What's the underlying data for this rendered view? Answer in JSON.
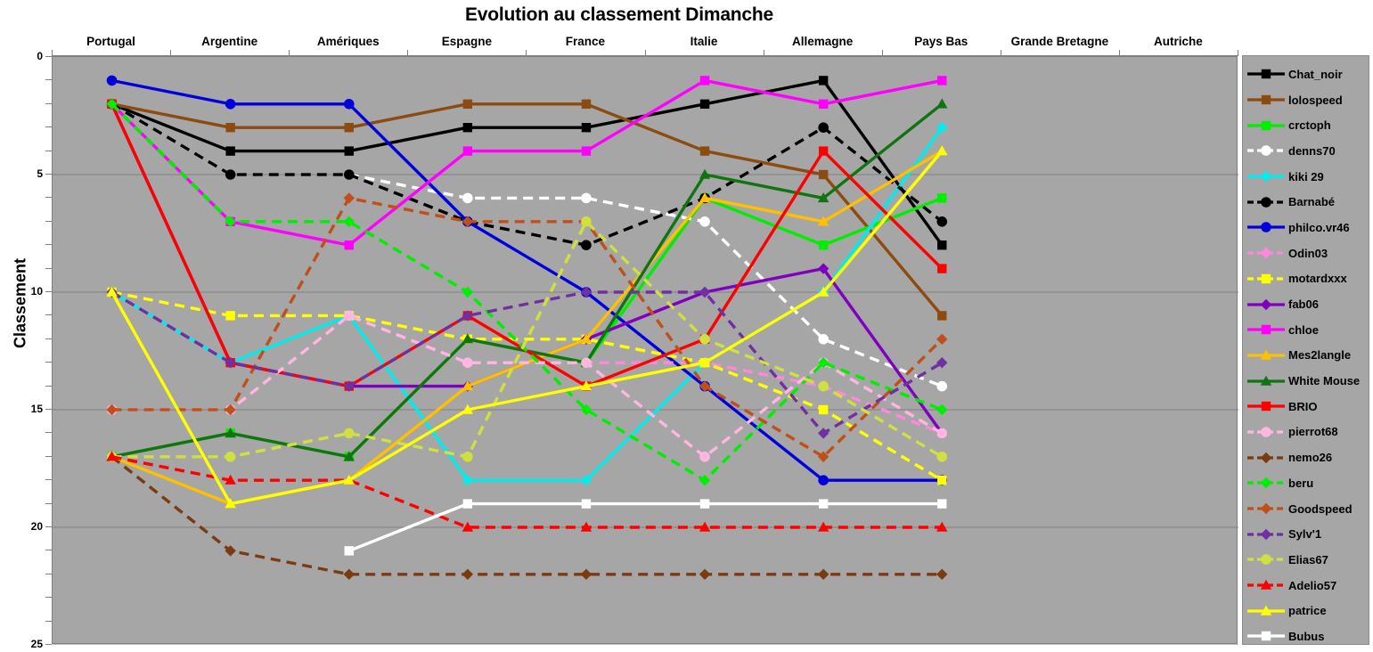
{
  "chart_data": {
    "type": "line",
    "title": "Evolution au classement Dimanche",
    "xlabel": "",
    "ylabel": "Classement",
    "categories": [
      "Portugal",
      "Argentine",
      "Amériques",
      "Espagne",
      "France",
      "Italie",
      "Allemagne",
      "Pays Bas",
      "Grande Bretagne",
      "Autriche"
    ],
    "x_tick_labels": [
      "Portugal",
      "Argentine",
      "Amériques",
      "Espagne",
      "France",
      "Italie",
      "Allemagne",
      "Pays Bas",
      "Grande Bretagne",
      "Autriche"
    ],
    "y_tick_labels": [
      "0",
      "5",
      "10",
      "15",
      "20",
      "25"
    ],
    "y_ticks": [
      0,
      5,
      10,
      15,
      20,
      25
    ],
    "ylim": [
      0,
      25
    ],
    "y_inverted": true,
    "grid": "horizontal",
    "legend_position": "right",
    "plot_background": "#a6a6a6",
    "series": [
      {
        "name": "Chat_noir",
        "color": "#000000",
        "marker": "square",
        "dash": "solid",
        "values": [
          2,
          4,
          4,
          3,
          3,
          2,
          1,
          8,
          null,
          null
        ]
      },
      {
        "name": "lolospeed",
        "color": "#8c4b10",
        "marker": "square",
        "dash": "solid",
        "values": [
          2,
          3,
          3,
          2,
          2,
          4,
          5,
          11,
          null,
          null
        ]
      },
      {
        "name": "crctoph",
        "color": "#00ee00",
        "marker": "square",
        "dash": "solid",
        "values": [
          17,
          16,
          17,
          12,
          13,
          6,
          8,
          6,
          null,
          null
        ]
      },
      {
        "name": "denns70",
        "color": "#ffffff",
        "marker": "circle",
        "dash": "dashed",
        "values": [
          2,
          5,
          5,
          6,
          6,
          7,
          12,
          14,
          null,
          null
        ]
      },
      {
        "name": "kiki 29",
        "color": "#00ecec",
        "marker": "diamond",
        "dash": "solid",
        "values": [
          10,
          13,
          11,
          18,
          18,
          13,
          10,
          3,
          null,
          null
        ]
      },
      {
        "name": "Barnabé",
        "color": "#000000",
        "marker": "circle",
        "dash": "dashed",
        "values": [
          2,
          5,
          5,
          7,
          8,
          6,
          3,
          7,
          null,
          null
        ]
      },
      {
        "name": "philco.vr46",
        "color": "#0000dd",
        "marker": "circle",
        "dash": "solid",
        "values": [
          1,
          2,
          2,
          7,
          10,
          14,
          18,
          18,
          null,
          null
        ]
      },
      {
        "name": "Odin03",
        "color": "#ff88dd",
        "marker": "diamond",
        "dash": "dashed",
        "values": [
          15,
          15,
          11,
          13,
          13,
          13,
          14,
          16,
          null,
          null
        ]
      },
      {
        "name": "motardxxx",
        "color": "#ffff00",
        "marker": "square",
        "dash": "dashed",
        "values": [
          10,
          11,
          11,
          12,
          12,
          13,
          15,
          18,
          null,
          null
        ]
      },
      {
        "name": "fab06",
        "color": "#8000c0",
        "marker": "diamond",
        "dash": "solid",
        "values": [
          2,
          13,
          14,
          14,
          12,
          10,
          9,
          16,
          null,
          null
        ]
      },
      {
        "name": "chloe",
        "color": "#ff00ff",
        "marker": "square",
        "dash": "solid",
        "values": [
          2,
          7,
          8,
          4,
          4,
          1,
          2,
          1,
          null,
          null
        ]
      },
      {
        "name": "Mes2langle",
        "color": "#ffc000",
        "marker": "triangle",
        "dash": "solid",
        "values": [
          17,
          19,
          18,
          14,
          12,
          6,
          7,
          4,
          null,
          null
        ]
      },
      {
        "name": "White Mouse",
        "color": "#107410",
        "marker": "triangle",
        "dash": "solid",
        "values": [
          17,
          16,
          17,
          12,
          13,
          5,
          6,
          2,
          null,
          null
        ]
      },
      {
        "name": "BRIO",
        "color": "#ff0000",
        "marker": "square",
        "dash": "solid",
        "values": [
          2,
          13,
          14,
          11,
          14,
          12,
          4,
          9,
          null,
          null
        ]
      },
      {
        "name": "pierrot68",
        "color": "#ffb6e0",
        "marker": "circle",
        "dash": "dashed",
        "values": [
          15,
          15,
          11,
          13,
          13,
          17,
          13,
          16,
          null,
          null
        ]
      },
      {
        "name": "nemo26",
        "color": "#7a3b10",
        "marker": "diamond",
        "dash": "dashed",
        "values": [
          17,
          21,
          22,
          22,
          22,
          22,
          22,
          22,
          null,
          null
        ]
      },
      {
        "name": "beru",
        "color": "#00ee00",
        "marker": "diamond",
        "dash": "dashed",
        "values": [
          2,
          7,
          7,
          10,
          15,
          18,
          13,
          15,
          null,
          null
        ]
      },
      {
        "name": "Goodspeed",
        "color": "#c0501a",
        "marker": "diamond",
        "dash": "dashed",
        "values": [
          15,
          15,
          6,
          7,
          7,
          14,
          17,
          12,
          null,
          null
        ]
      },
      {
        "name": "Sylv'1",
        "color": "#7030a0",
        "marker": "diamond",
        "dash": "dashed",
        "values": [
          10,
          13,
          14,
          11,
          10,
          10,
          16,
          13,
          null,
          null
        ]
      },
      {
        "name": "Elias67",
        "color": "#d0e040",
        "marker": "circle",
        "dash": "dashed",
        "values": [
          17,
          17,
          16,
          17,
          7,
          12,
          14,
          17,
          null,
          null
        ]
      },
      {
        "name": "Adelio57",
        "color": "#ff0000",
        "marker": "triangle",
        "dash": "dashed",
        "values": [
          17,
          18,
          18,
          20,
          20,
          20,
          20,
          20,
          null,
          null
        ]
      },
      {
        "name": "patrice",
        "color": "#ffff00",
        "marker": "triangle",
        "dash": "solid",
        "values": [
          10,
          19,
          18,
          15,
          14,
          13,
          10,
          4,
          null,
          null
        ]
      },
      {
        "name": "Bubus",
        "color": "#ffffff",
        "marker": "square",
        "dash": "solid",
        "values": [
          null,
          null,
          21,
          19,
          19,
          19,
          19,
          19,
          null,
          null
        ]
      }
    ]
  }
}
